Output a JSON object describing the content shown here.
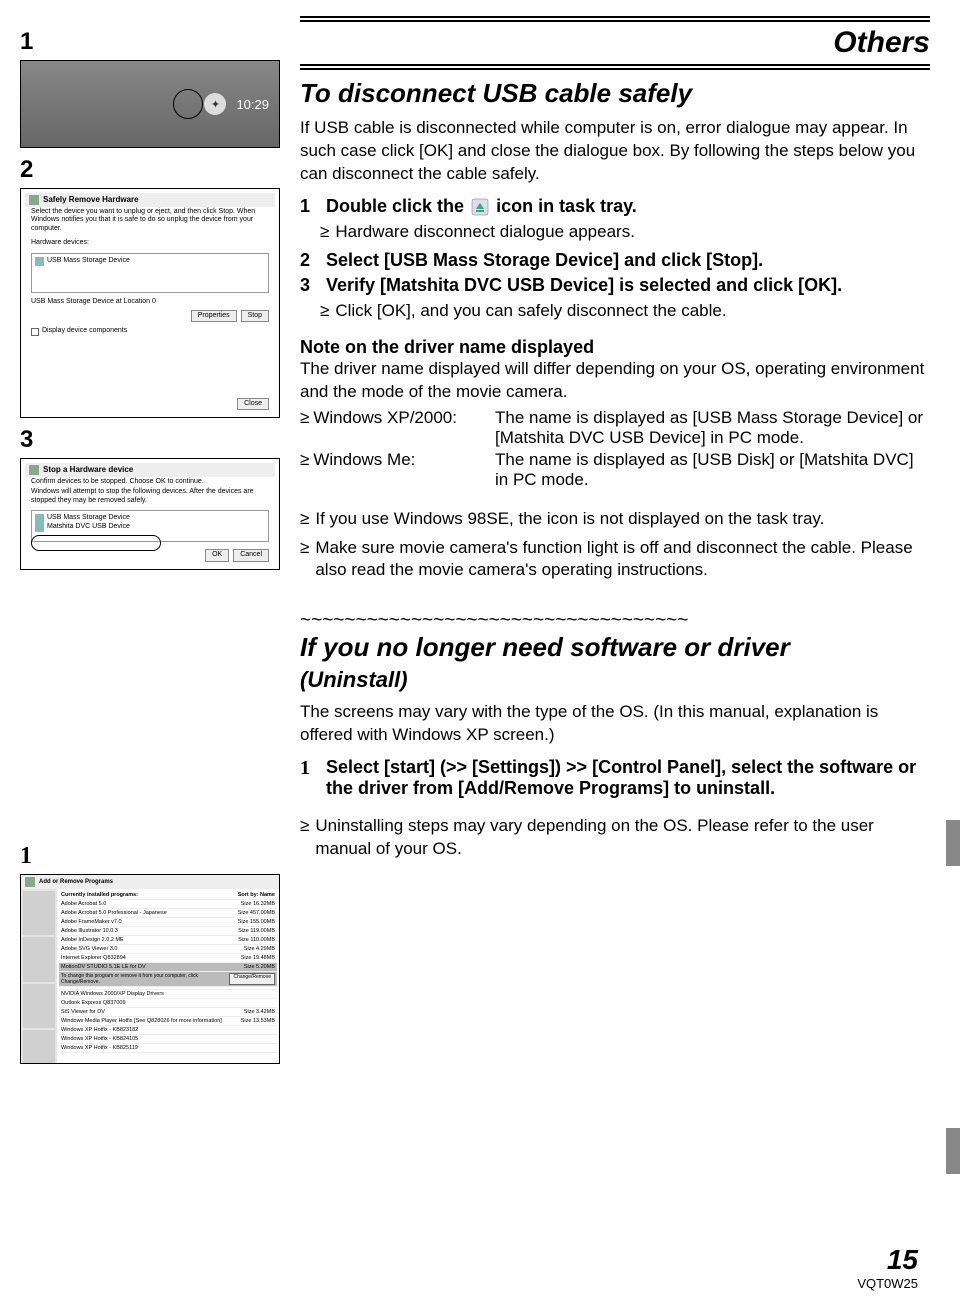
{
  "header": {
    "section_title": "Others"
  },
  "subheading1": "To disconnect USB cable safely",
  "intro": "If USB cable is disconnected while computer is on, error dialogue may appear. In such case click [OK] and close the dialogue box. By following the steps below you can disconnect the cable safely.",
  "steps": [
    {
      "num": "1",
      "text_before": "Double click the ",
      "text_after": " icon in task tray.",
      "sub": "Hardware disconnect dialogue appears."
    },
    {
      "num": "2",
      "text": "Select [USB Mass Storage Device] and click [Stop]."
    },
    {
      "num": "3",
      "text": "Verify [Matshita DVC USB Device] is selected and click [OK].",
      "sub": "Click [OK], and you can safely disconnect the cable."
    }
  ],
  "note": {
    "heading": "Note on the driver name displayed",
    "body": "The driver name displayed will differ depending on your OS, operating environment and the mode of the movie camera.",
    "os_rows": [
      {
        "label": "Windows XP/2000:",
        "desc": "The name is displayed as [USB Mass Storage Device] or [Matshita DVC USB Device] in PC mode."
      },
      {
        "label": "Windows Me:",
        "desc": "The name is displayed as [USB Disk] or [Matshita DVC] in PC mode."
      }
    ]
  },
  "extra_bullets": [
    "If you use Windows 98SE, the icon is not displayed on the task tray.",
    "Make sure movie camera's function light is off and disconnect the cable. Please also read the movie camera's operating instructions."
  ],
  "wave": "~~~~~~~~~~~~~~~~~~~~~~~~~~~~~~~~~~~",
  "subheading2": "If you no longer need software or driver",
  "subheading2_sub": "(Uninstall)",
  "uninstall_intro": "The screens may vary with the type of the OS. (In this manual, explanation is offered with Windows XP screen.)",
  "uninstall_step": {
    "num": "1",
    "text": "Select [start] (>> [Settings]) >> [Control Panel], select the software or the driver from [Add/Remove Programs] to uninstall."
  },
  "uninstall_bullet": "Uninstalling steps may vary depending on the OS. Please refer to the user manual of your OS.",
  "footer": {
    "page": "15",
    "code": "VQT0W25"
  },
  "thumbs": {
    "t1_label": "1",
    "t1_time": "10:29",
    "t2_label": "2",
    "t2_title": "Safely Remove Hardware",
    "t2_desc1": "Select the device you want to unplug or eject, and then click Stop. When Windows notifies you that it is safe to do so unplug the device from your computer.",
    "t2_hw_label": "Hardware devices:",
    "t2_list_item": "USB Mass Storage Device",
    "t2_status": "USB Mass Storage Device at Location 0",
    "t2_btn_properties": "Properties",
    "t2_btn_stop": "Stop",
    "t2_checkbox": "Display device components",
    "t2_btn_close": "Close",
    "t3_label": "3",
    "t3_title": "Stop a Hardware device",
    "t3_desc1": "Confirm devices to be stopped. Choose OK to continue.",
    "t3_desc2": "Windows will attempt to stop the following devices. After the devices are stopped they may be removed safely.",
    "t3_item1": "USB Mass Storage Device",
    "t3_item2": "Matshita DVC USB Device",
    "t3_btn_ok": "OK",
    "t3_btn_cancel": "Cancel",
    "t4_label": "1",
    "t4_title": "Add or Remove Programs",
    "t4_hdr": "Currently installed programs:",
    "t4_rows": [
      {
        "n": "Adobe Acrobat 5.0",
        "s": "Size 16.32MB"
      },
      {
        "n": "Adobe Acrobat 5.0 Professional - Japanese",
        "s": "Size 457.00MB"
      },
      {
        "n": "Adobe FrameMaker v7.0",
        "s": "Size 155.00MB"
      },
      {
        "n": "Adobe Illustrator 10.0.3",
        "s": "Size 119.00MB"
      },
      {
        "n": "Adobe InDesign 2.0.2 ME",
        "s": "Size 110.00MB"
      },
      {
        "n": "Adobe SVG Viewer 3.0",
        "s": "Size 4.29MB"
      },
      {
        "n": "Internet Explorer Q832894",
        "s": "Size 19.48MB"
      },
      {
        "n": "MotionDV STUDIO 5.1E LE for DV",
        "s": "Size 5.20MB"
      },
      {
        "n": "",
        "s": ""
      },
      {
        "n": "NVIDIA Windows 2000/XP Display Drivers",
        "s": ""
      },
      {
        "n": "Outlook Express Q837009",
        "s": ""
      },
      {
        "n": "SiS Viewer for DV",
        "s": "Size 3.42MB"
      },
      {
        "n": "Windows Media Player Hotfix [See Q828026 for more information]",
        "s": "Size 13.53MB"
      },
      {
        "n": "Windows XP Hotfix - KB823182",
        "s": ""
      },
      {
        "n": "Windows XP Hotfix - KB824105",
        "s": ""
      },
      {
        "n": "Windows XP Hotfix - KB825119",
        "s": ""
      }
    ],
    "t4_sel_info": "To change this program or remove it from your computer, click Change/Remove.",
    "t4_btn": "Change/Remove"
  }
}
